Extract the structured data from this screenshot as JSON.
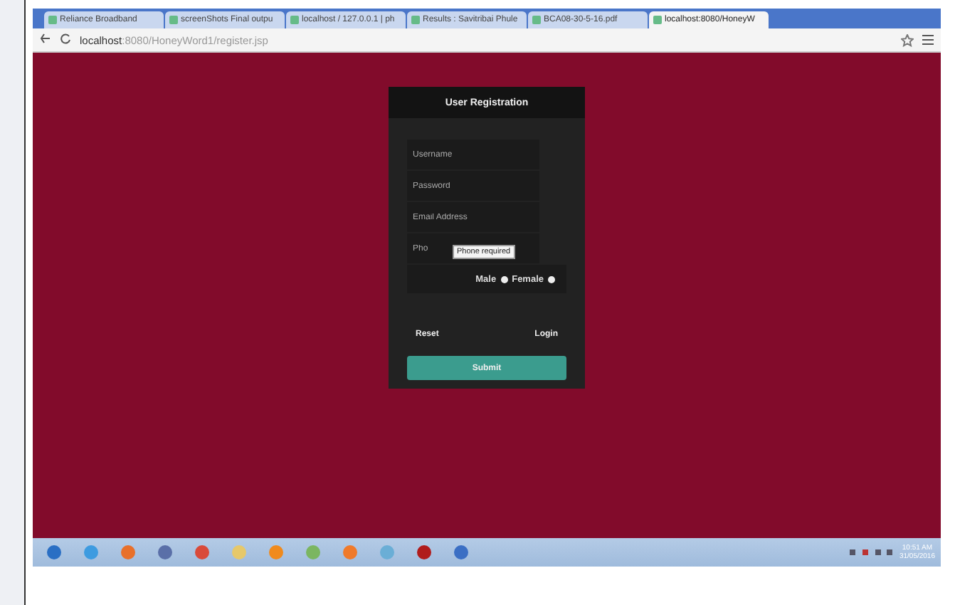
{
  "browser": {
    "tabs": [
      {
        "label": "Reliance Broadband",
        "selected": false
      },
      {
        "label": "screenShots Final outpu",
        "selected": false
      },
      {
        "label": "localhost / 127.0.0.1 | ph",
        "selected": false
      },
      {
        "label": "Results : Savitribai Phule",
        "selected": false
      },
      {
        "label": "BCA08-30-5-16.pdf",
        "selected": false
      },
      {
        "label": "localhost:8080/HoneyW",
        "selected": true
      }
    ],
    "address": {
      "host": "localhost",
      "path": ":8080/HoneyWord1/register.jsp"
    }
  },
  "form": {
    "title": "User Registration",
    "fields": [
      {
        "placeholder": "Username"
      },
      {
        "placeholder": "Password"
      },
      {
        "placeholder": "Email Address"
      },
      {
        "placeholder": "Pho"
      }
    ],
    "tooltip": "Phone required",
    "gender": [
      {
        "label": "Male",
        "selected": false
      },
      {
        "label": "Female",
        "selected": false
      }
    ],
    "links": [
      "Reset",
      "Login"
    ],
    "submit": "Submit"
  },
  "taskbar": {
    "time": "10:51 AM",
    "date": "31/05/2016"
  }
}
